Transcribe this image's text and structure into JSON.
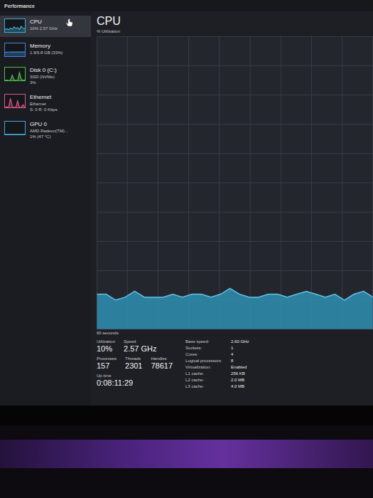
{
  "window": {
    "title": "Performance"
  },
  "sidebar": {
    "items": [
      {
        "name": "CPU",
        "details": [
          "10% 2.57 GHz"
        ],
        "selected": true,
        "color": "#3fa9d6",
        "graph": [
          20,
          25,
          18,
          30,
          22,
          40,
          28,
          35,
          20,
          45,
          30,
          25
        ]
      },
      {
        "name": "Memory",
        "details": [
          "1.9/5.8 GB (33%)"
        ],
        "selected": false,
        "color": "#3f86d6",
        "graph": [
          30,
          31,
          32,
          33,
          33,
          33,
          33,
          33,
          33,
          33,
          33,
          33
        ]
      },
      {
        "name": "Disk 0 (C:)",
        "details": [
          "SSD (NVMe)",
          "3%"
        ],
        "selected": false,
        "color": "#4cc24c",
        "graph": [
          0,
          2,
          0,
          0,
          40,
          5,
          0,
          0,
          60,
          10,
          0,
          3
        ]
      },
      {
        "name": "Ethernet",
        "details": [
          "Ethernet",
          "S: 0 R: 0 Kbps"
        ],
        "selected": false,
        "color": "#d65a8a",
        "graph": [
          0,
          5,
          0,
          70,
          10,
          0,
          0,
          50,
          0,
          0,
          20,
          0
        ]
      },
      {
        "name": "GPU 0",
        "details": [
          "AMD Radeon(TM)...",
          "1% (47 °C)"
        ],
        "selected": false,
        "color": "#3fa9d6",
        "graph": [
          1,
          1,
          1,
          1,
          1,
          1,
          1,
          1,
          1,
          1,
          1,
          1
        ]
      }
    ]
  },
  "main": {
    "title": "CPU",
    "axis_label": "% Utilization",
    "time_label": "60 seconds",
    "series": [
      12,
      12,
      10,
      11,
      13,
      11,
      11,
      11,
      12,
      11,
      12,
      12,
      11,
      12,
      14,
      12,
      11,
      11,
      12,
      12,
      11,
      12,
      13,
      12,
      11,
      12,
      10,
      12,
      13,
      11
    ],
    "stat_rows": [
      [
        {
          "label": "Utilization",
          "value": "10%"
        },
        {
          "label": "Speed",
          "value": "2.57 GHz"
        }
      ],
      [
        {
          "label": "Processes",
          "value": "157"
        },
        {
          "label": "Threads",
          "value": "2301"
        },
        {
          "label": "Handles",
          "value": "78617"
        }
      ],
      [
        {
          "label": "Up time",
          "value": "0:08:11:29"
        }
      ]
    ],
    "specs": [
      {
        "label": "Base speed:",
        "value": "2.60 GHz"
      },
      {
        "label": "Sockets:",
        "value": "1"
      },
      {
        "label": "Cores:",
        "value": "4"
      },
      {
        "label": "Logical processors:",
        "value": "8"
      },
      {
        "label": "Virtualization:",
        "value": "Enabled"
      },
      {
        "label": "L1 cache:",
        "value": "256 KB"
      },
      {
        "label": "L2 cache:",
        "value": "2.0 MB"
      },
      {
        "label": "L3 cache:",
        "value": "4.0 MB"
      }
    ]
  }
}
